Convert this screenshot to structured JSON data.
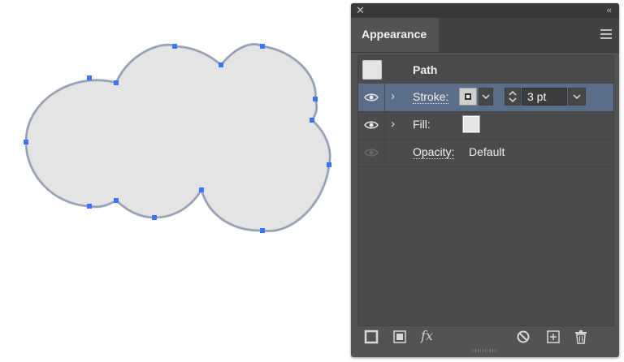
{
  "panel": {
    "close_glyph": "✕",
    "collapse_glyph": "‹‹",
    "tab_label": "Appearance",
    "menu_icon": "hamburger-menu-icon"
  },
  "rows": {
    "path": {
      "label": "Path"
    },
    "stroke": {
      "label": "Stroke:",
      "weight": "3 pt",
      "chevron": "›"
    },
    "fill": {
      "label": "Fill:",
      "chevron": "›"
    },
    "opacity": {
      "label": "Opacity:",
      "value": "Default"
    }
  },
  "bottom_bar": {
    "fx_label": "fx",
    "icons": [
      "add-new-stroke-icon",
      "add-new-fill-icon",
      "fx-icon",
      "clear-appearance-icon",
      "duplicate-item-icon",
      "delete-icon"
    ]
  },
  "colors": {
    "panel_bg": "#535353",
    "selected_row": "#5b6e89",
    "shape_fill": "#e4e4e4",
    "path_stroke": "#8da0c8",
    "anchor_point": "#2f6bff"
  }
}
